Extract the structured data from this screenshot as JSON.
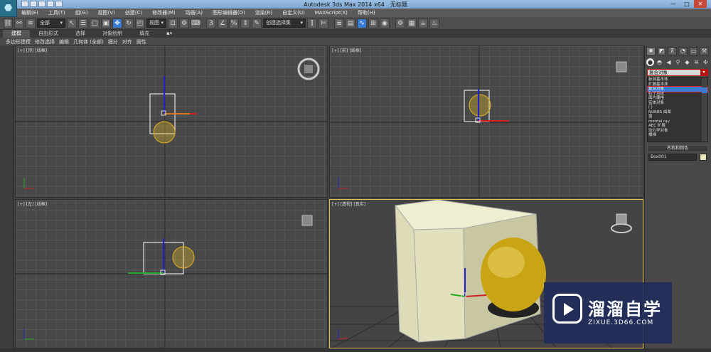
{
  "title_bar": {
    "app": "Autodesk 3ds Max  2014 x64",
    "file": "无标题"
  },
  "window": {
    "min": "—",
    "max": "□",
    "close": "✕"
  },
  "menu": [
    "编辑(E)",
    "工具(T)",
    "组(G)",
    "视图(V)",
    "创建(C)",
    "修改器(M)",
    "动画(A)",
    "图形编辑器(D)",
    "渲染(R)",
    "自定义(U)",
    "MAXScript(X)",
    "帮助(H)"
  ],
  "toolbar": {
    "selection_filter": "全部",
    "ref_coord": "视图",
    "named_selection": "创建选择集"
  },
  "ribbon": {
    "tabs": [
      "建模",
      "自由形式",
      "选择",
      "对象绘制",
      "填充"
    ]
  },
  "subribbon": [
    "多边形建模",
    "修改选择",
    "编辑",
    "几何体 (全部)",
    "细分",
    "对齐",
    "属性"
  ],
  "viewports": {
    "top": [
      "[+]",
      "[顶]",
      "[线框]"
    ],
    "front": [
      "[+]",
      "[前]",
      "[线框]"
    ],
    "left": [
      "[+]",
      "[左]",
      "[线框]"
    ],
    "persp": [
      "[+]",
      "[透视]",
      "[真实]"
    ]
  },
  "command_panel": {
    "category_selected": "复合对象",
    "category_list": [
      "标准基本体",
      "扩展基本体",
      "复合对象",
      "粒子系统",
      "面片栅格",
      "实体对象",
      "门",
      "NURBS 曲面",
      "窗",
      "mental ray",
      "AEC 扩展",
      "动力学对象",
      "楼梯"
    ],
    "name_color_header": "名称和颜色",
    "object_name": "Box001",
    "object_color": "#e9e6b8"
  },
  "watermark": {
    "title": "溜溜自学",
    "url": "ZIXUE.3D66.COM"
  }
}
